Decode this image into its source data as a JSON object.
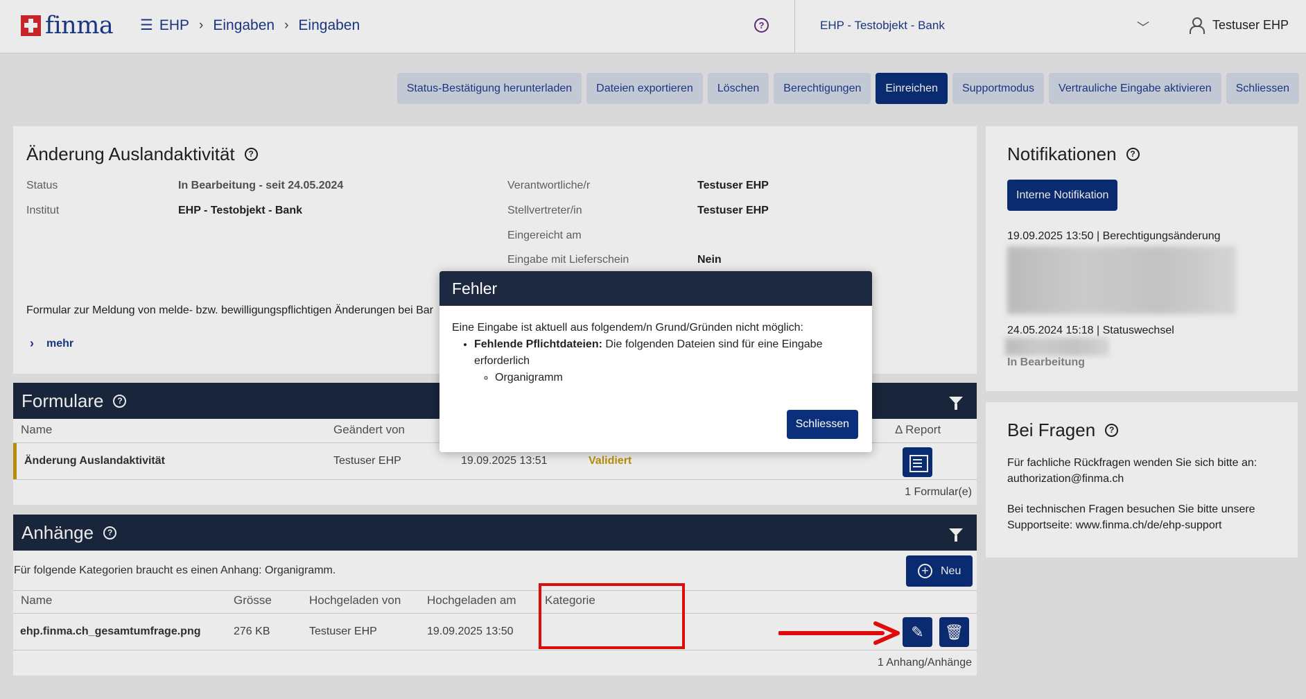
{
  "header": {
    "logo_text": "finma",
    "breadcrumb": [
      "EHP",
      "Eingaben",
      "Eingaben"
    ],
    "help_icon": "help-circle-icon",
    "institution": "EHP - Testobjekt - Bank",
    "user": "Testuser EHP"
  },
  "toolbar": {
    "status_download": "Status-Bestätigung herunterladen",
    "export_files": "Dateien exportieren",
    "delete": "Löschen",
    "permissions": "Berechtigungen",
    "submit": "Einreichen",
    "support_mode": "Supportmodus",
    "confidential": "Vertrauliche Eingabe aktivieren",
    "close": "Schliessen"
  },
  "main": {
    "title": "Änderung Auslandaktivität",
    "status_label": "Status",
    "status_value": "In Bearbeitung - seit 24.05.2024",
    "institute_label": "Institut",
    "institute_value": "EHP - Testobjekt - Bank",
    "responsible_label": "Verantwortliche/r",
    "responsible_value": "Testuser EHP",
    "deputy_label": "Stellvertreter/in",
    "deputy_value": "Testuser EHP",
    "submitted_label": "Eingereicht am",
    "submitted_value": "",
    "delivery_label": "Eingabe mit Lieferschein",
    "delivery_value": "Nein",
    "description": "Formular zur Meldung von melde- bzw. bewilligungspflichtigen Änderungen bei Bar",
    "more": "mehr"
  },
  "forms": {
    "title": "Formulare",
    "columns": [
      "Name",
      "Geändert von",
      "",
      "",
      "Δ Report"
    ],
    "rows": [
      {
        "name": "Änderung Auslandaktivität",
        "changed_by": "Testuser EHP",
        "date": "19.09.2025 13:51",
        "status": "Validiert"
      }
    ],
    "footer": "1 Formular(e)"
  },
  "attachments": {
    "title": "Anhänge",
    "notice": "Für folgende Kategorien braucht es einen Anhang: Organigramm.",
    "new_button": "Neu",
    "columns": [
      "Name",
      "Grösse",
      "Hochgeladen von",
      "Hochgeladen am",
      "Kategorie"
    ],
    "rows": [
      {
        "name": "ehp.finma.ch_gesamtumfrage.png",
        "size": "276 KB",
        "uploaded_by": "Testuser EHP",
        "uploaded_at": "19.09.2025 13:50",
        "category": ""
      }
    ],
    "footer": "1 Anhang/Anhänge"
  },
  "notifications": {
    "title": "Notifikationen",
    "internal_button": "Interne Notifikation",
    "items": [
      {
        "header": "19.09.2025 13:50 | Berechtigungsänderung"
      },
      {
        "header": "24.05.2024 15:18 | Statuswechsel",
        "status": "In Bearbeitung"
      }
    ]
  },
  "questions": {
    "title": "Bei Fragen",
    "line1": "Für fachliche Rückfragen wenden Sie sich bitte an: authorization@finma.ch",
    "line2": "Bei technischen Fragen besuchen Sie bitte unsere Supportseite: www.finma.ch/de/ehp-support"
  },
  "modal": {
    "title": "Fehler",
    "intro": "Eine Eingabe ist aktuell aus folgendem/n Grund/Gründen nicht möglich:",
    "reason_bold": "Fehlende Pflichtdateien:",
    "reason_text": " Die folgenden Dateien sind für eine Eingabe erforderlich",
    "missing_file": "Organigramm",
    "close": "Schliessen"
  },
  "colors": {
    "primary": "#0b2f7a",
    "header_dark": "#1c2940",
    "validated": "#c89a0a",
    "annotation": "#e00b0b"
  }
}
